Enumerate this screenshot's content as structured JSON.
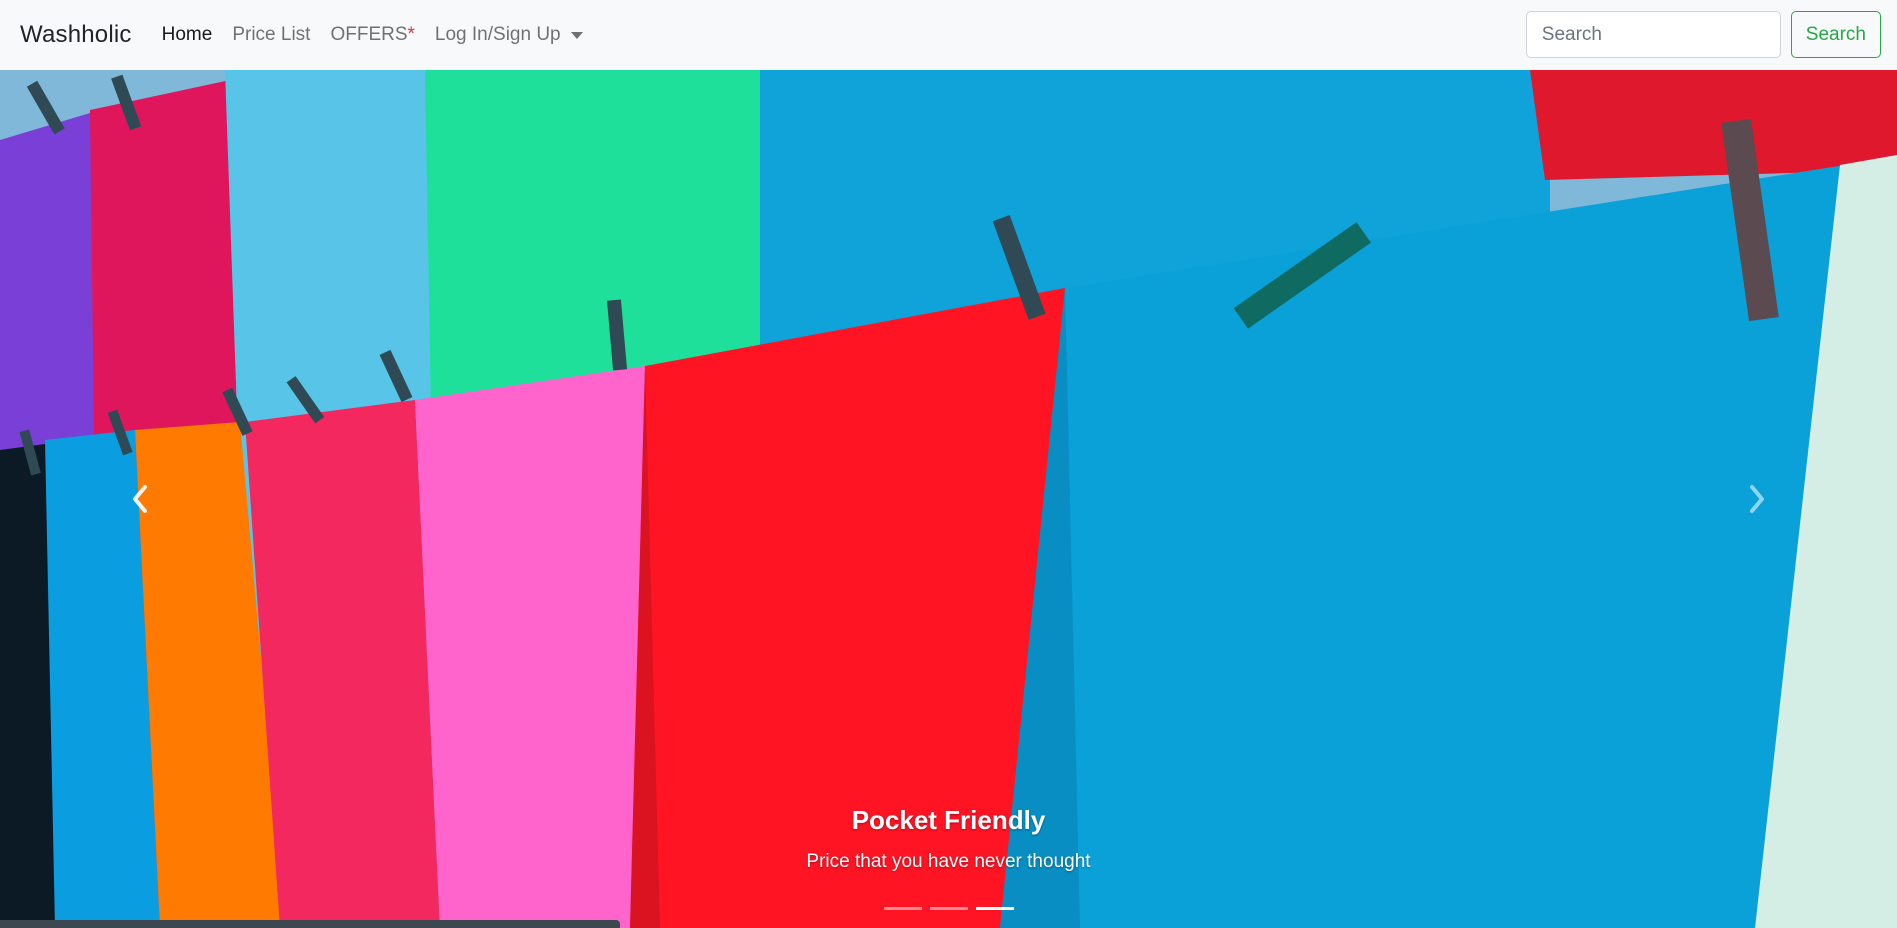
{
  "navbar": {
    "brand": "Washholic",
    "links": {
      "home": "Home",
      "price_list": "Price List",
      "offers": "OFFERS",
      "offers_marker": "*",
      "login": "Log In/Sign Up"
    },
    "search": {
      "placeholder": "Search",
      "button_label": "Search"
    }
  },
  "carousel": {
    "caption_title": "Pocket Friendly",
    "caption_text": "Price that you have never thought",
    "slide_count": 3,
    "active_slide": 3,
    "icons": {
      "prev": "chevron-left-icon",
      "next": "chevron-right-icon"
    }
  },
  "colors": {
    "navbar_bg": "#f8f9fa",
    "success": "#28a745",
    "danger": "#dc3545"
  }
}
